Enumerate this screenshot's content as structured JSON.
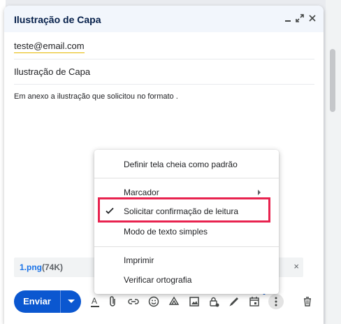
{
  "compose": {
    "title": "Ilustração de Capa",
    "minimize_icon": "minimize-icon",
    "expand_icon": "expand-icon",
    "close_icon": "close-icon",
    "to": "teste@email.com",
    "subject": "Ilustração de Capa",
    "body": "Em anexo a ilustração que solicitou no formato ."
  },
  "attachment": {
    "name": "1.png",
    "size": "(74K)",
    "remove": "×"
  },
  "toolbar": {
    "send_label": "Enviar",
    "icons": [
      "formatting-options-icon",
      "attach-file-icon",
      "insert-link-icon",
      "emoji-icon",
      "drive-icon",
      "insert-photo-icon",
      "confidential-mode-icon",
      "signature-icon",
      "schedule-icon",
      "more-options-icon",
      "delete-icon"
    ]
  },
  "menu": {
    "items": [
      {
        "label": "Definir tela cheia como padrão"
      },
      {
        "label": "Marcador"
      },
      {
        "label": "Solicitar confirmação de leitura",
        "checked": true
      },
      {
        "label": "Modo de texto simples"
      },
      {
        "label": "Imprimir"
      },
      {
        "label": "Verificar ortografia"
      }
    ]
  },
  "highlight_color": "#e8234f",
  "accent_color": "#0b57d0"
}
